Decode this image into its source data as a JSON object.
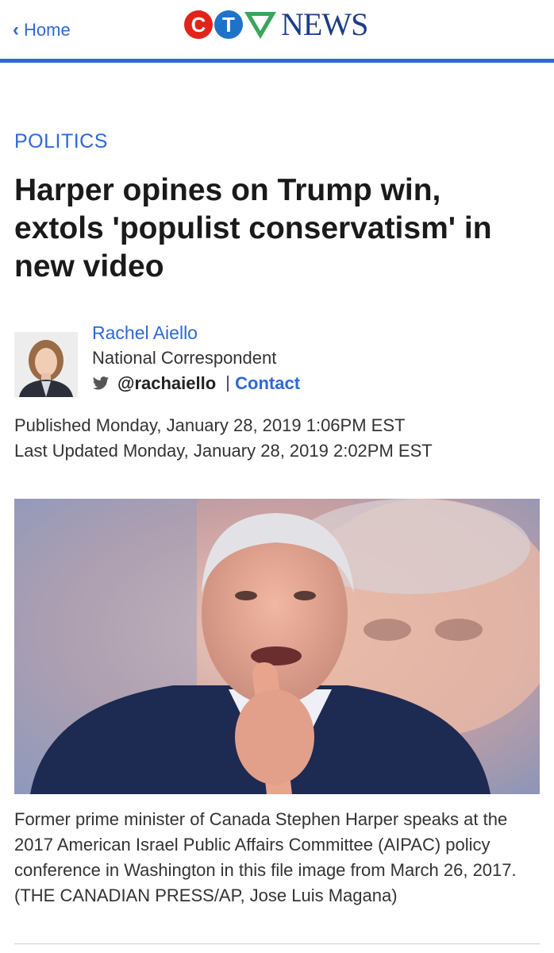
{
  "nav": {
    "back_label": "Home"
  },
  "brand": {
    "logo_c": "C",
    "logo_t": "T",
    "logo_word": "NEWS",
    "accent": "#2f68d8",
    "logo_red": "#e2231a",
    "logo_blue": "#1e73c8",
    "logo_green": "#3ba55c"
  },
  "article": {
    "section": "POLITICS",
    "headline": "Harper opines on Trump win, extols 'populist conservatism' in new video",
    "author": {
      "name": "Rachel Aiello",
      "role": "National Correspondent",
      "twitter_handle": "@rachaiello",
      "contact_label": "Contact"
    },
    "published": "Published Monday, January 28, 2019 1:06PM EST",
    "updated": "Last Updated Monday, January 28, 2019 2:02PM EST",
    "caption": "Former prime minister of Canada Stephen Harper speaks at the 2017 American Israel Public Affairs Committee (AIPAC) policy conference in Washington in this file image from March 26, 2017. (THE CANADIAN PRESS/AP, Jose Luis Magana)"
  }
}
